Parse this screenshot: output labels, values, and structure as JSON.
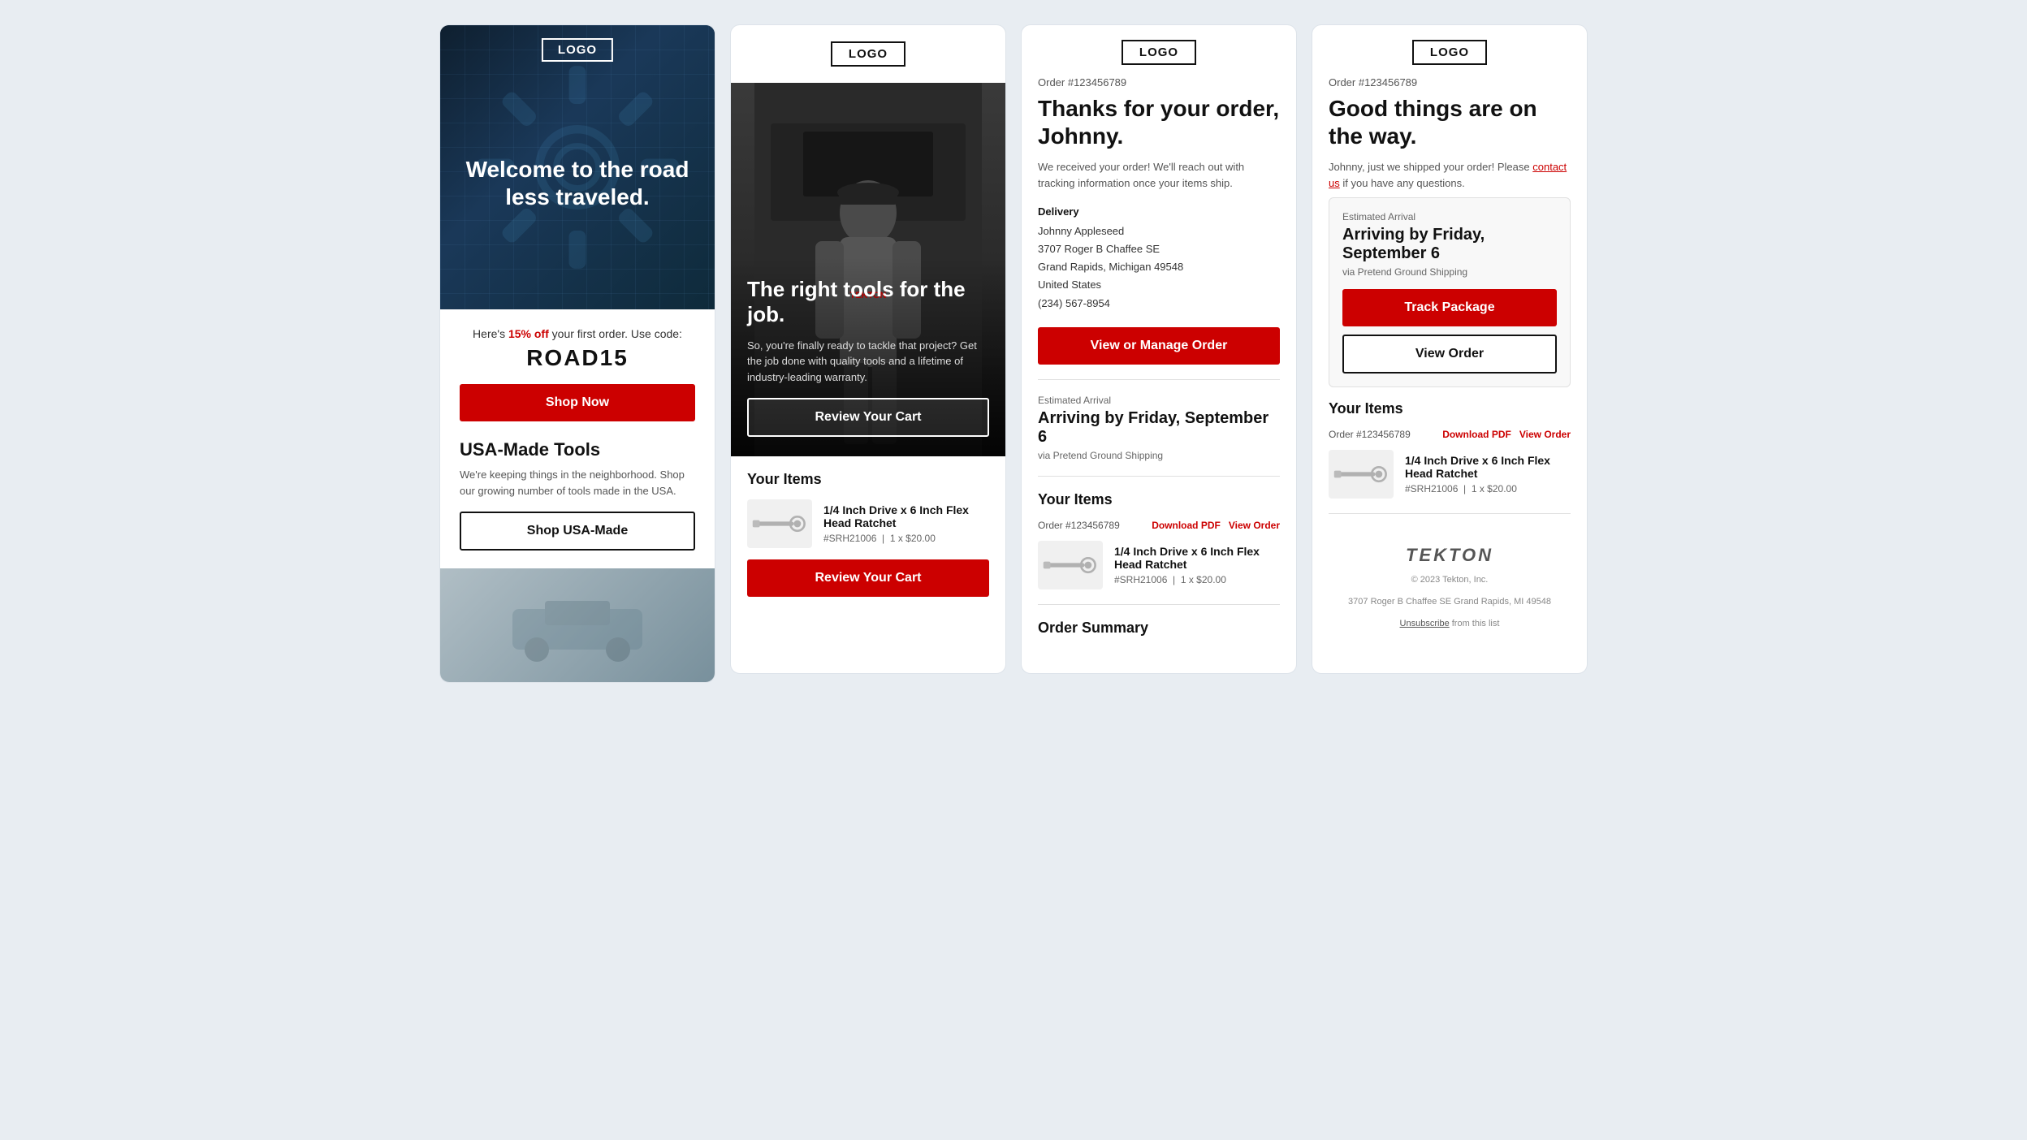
{
  "card1": {
    "logo": "LOGO",
    "hero_text": "Welcome to the road less traveled.",
    "promo_prefix": "Here's",
    "promo_highlight": "15% off",
    "promo_suffix": "your first order. Use code:",
    "promo_code": "ROAD15",
    "shop_now": "Shop Now",
    "section_title": "USA-Made Tools",
    "section_text": "We're keeping things in the neighborhood. Shop our growing number of tools made in the USA.",
    "shop_usa_label": "Shop USA-Made"
  },
  "card2": {
    "logo": "LOGO",
    "hero_title": "The right tools for the job.",
    "hero_subtitle": "So, you're finally ready to tackle that project? Get the job done with quality tools and a lifetime of industry-leading warranty.",
    "cta": "Review Your Cart",
    "items_title": "Your Items",
    "item_name": "1/4 Inch Drive x 6 Inch Flex Head Ratchet",
    "item_sku": "#SRH21006",
    "item_qty_price": "1 x $20.00",
    "review_cart": "Review Your Cart"
  },
  "card3": {
    "logo": "LOGO",
    "order_number": "Order #123456789",
    "title": "Thanks for your order, Johnny.",
    "subtitle": "We received your order! We'll reach out with tracking information once your items ship.",
    "delivery_label": "Delivery",
    "delivery_name": "Johnny Appleseed",
    "delivery_address1": "3707 Roger B Chaffee SE",
    "delivery_city": "Grand Rapids, Michigan 49548",
    "delivery_country": "United States",
    "delivery_phone": "(234) 567-8954",
    "view_manage_order": "View or Manage Order",
    "arrival_label": "Estimated Arrival",
    "arrival_date": "Arriving by Friday, September 6",
    "arrival_via": "via Pretend Ground Shipping",
    "items_title": "Your Items",
    "items_order": "Order #123456789",
    "download_pdf": "Download PDF",
    "view_order": "View Order",
    "item_name": "1/4 Inch Drive x 6 Inch Flex Head Ratchet",
    "item_sku": "#SRH21006",
    "item_qty_price": "1 x $20.00",
    "order_summary_title": "Order Summary"
  },
  "card4": {
    "logo": "LOGO",
    "order_number": "Order #123456789",
    "title": "Good things are on the way.",
    "subtitle_prefix": "Johnny, just we shipped your order! Please",
    "contact_link": "contact us",
    "subtitle_suffix": "if you have any questions.",
    "arrival_label": "Estimated Arrival",
    "arrival_date": "Arriving by Friday, September 6",
    "arrival_via": "via Pretend Ground Shipping",
    "track_package": "Track Package",
    "view_order": "View Order",
    "items_title": "Your Items",
    "items_order": "Order #123456789",
    "download_pdf": "Download PDF",
    "view_order_link": "View Order",
    "item_name": "1/4 Inch Drive x 6 Inch Flex Head Ratchet",
    "item_sku": "#SRH21006",
    "item_qty_price": "1 x $20.00",
    "tekton_brand": "TEKTON",
    "footer_copyright": "© 2023 Tekton, Inc.",
    "footer_address": "3707 Roger B Chaffee SE Grand Rapids, MI 49548",
    "unsubscribe": "Unsubscribe",
    "footer_unsubscribe_suffix": "from this list"
  }
}
